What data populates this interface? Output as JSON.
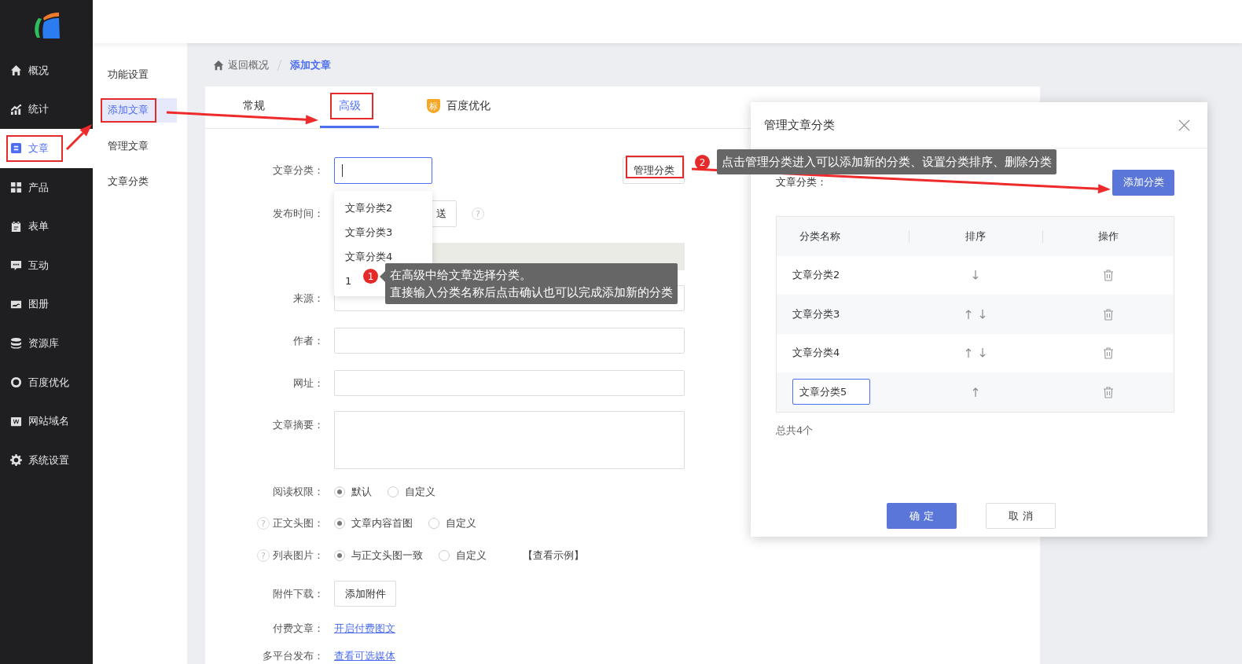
{
  "nav": [
    {
      "label": "概况",
      "selected": false
    },
    {
      "label": "统计",
      "selected": false
    },
    {
      "label": "文章",
      "selected": true
    },
    {
      "label": "产品",
      "selected": false
    },
    {
      "label": "表单",
      "selected": false
    },
    {
      "label": "互动",
      "selected": false
    },
    {
      "label": "图册",
      "selected": false
    },
    {
      "label": "资源库",
      "selected": false
    },
    {
      "label": "百度优化",
      "selected": false
    },
    {
      "label": "网站域名",
      "selected": false
    },
    {
      "label": "系统设置",
      "selected": false
    }
  ],
  "subnav": [
    {
      "label": "功能设置",
      "selected": false
    },
    {
      "label": "添加文章",
      "selected": true
    },
    {
      "label": "管理文章",
      "selected": false
    },
    {
      "label": "文章分类",
      "selected": false
    }
  ],
  "breadcrumb": {
    "back": "返回概况",
    "current": "添加文章"
  },
  "tabs": [
    {
      "label": "常规",
      "selected": false
    },
    {
      "label": "高级",
      "selected": true
    },
    {
      "label": "百度优化",
      "selected": false,
      "badge": "标"
    }
  ],
  "form": {
    "category": {
      "label": "文章分类：",
      "focused": true,
      "button": "管理分类"
    },
    "publish_time": {
      "label": "发布时间：",
      "button": "送",
      "help": "?"
    },
    "source": {
      "label": "来源："
    },
    "author": {
      "label": "作者："
    },
    "url": {
      "label": "网址："
    },
    "summary": {
      "label": "文章摘要："
    },
    "radios": [
      {
        "label": "阅读权限：",
        "options": [
          {
            "label": "默认",
            "selected": true
          },
          {
            "label": "自定义",
            "selected": false
          }
        ]
      },
      {
        "label": "正文头图：",
        "help": "?",
        "options": [
          {
            "label": "文章内容首图",
            "selected": true
          },
          {
            "label": "自定义",
            "selected": false
          }
        ]
      },
      {
        "label": "列表图片：",
        "help": "?",
        "options": [
          {
            "label": "与正文头图一致",
            "selected": true
          },
          {
            "label": "自定义",
            "selected": false
          }
        ],
        "link": "【查看示例】"
      }
    ],
    "attachment": {
      "label": "附件下载：",
      "button": "添加附件"
    },
    "links": [
      {
        "label": "付费文章：",
        "link": "开启付费图文"
      },
      {
        "label": "多平台发布：",
        "link": "查看可选媒体"
      }
    ]
  },
  "dropdown": [
    "文章分类2",
    "文章分类3",
    "文章分类4",
    "1"
  ],
  "callouts": [
    {
      "number": "1",
      "lines": [
        "在高级中给文章选择分类。",
        "直接输入分类名称后点击确认也可以完成添加新的分类"
      ]
    },
    {
      "number": "2",
      "lines": [
        "点击管理分类进入可以添加新的分类、设置分类排序、删除分类"
      ]
    }
  ],
  "dialog": {
    "title": "管理文章分类",
    "label": "文章分类：",
    "add_button": "添加分类",
    "columns": [
      "分类名称",
      "排序",
      "操作"
    ],
    "rows": [
      {
        "name": "文章分类2",
        "up": false,
        "down": true,
        "editing": false
      },
      {
        "name": "文章分类3",
        "up": true,
        "down": true,
        "editing": false
      },
      {
        "name": "文章分类4",
        "up": true,
        "down": true,
        "editing": false
      },
      {
        "name": "文章分类5",
        "up": true,
        "down": false,
        "editing": true
      }
    ],
    "total": "总共4个",
    "ok": "确 定",
    "cancel": "取 消"
  }
}
